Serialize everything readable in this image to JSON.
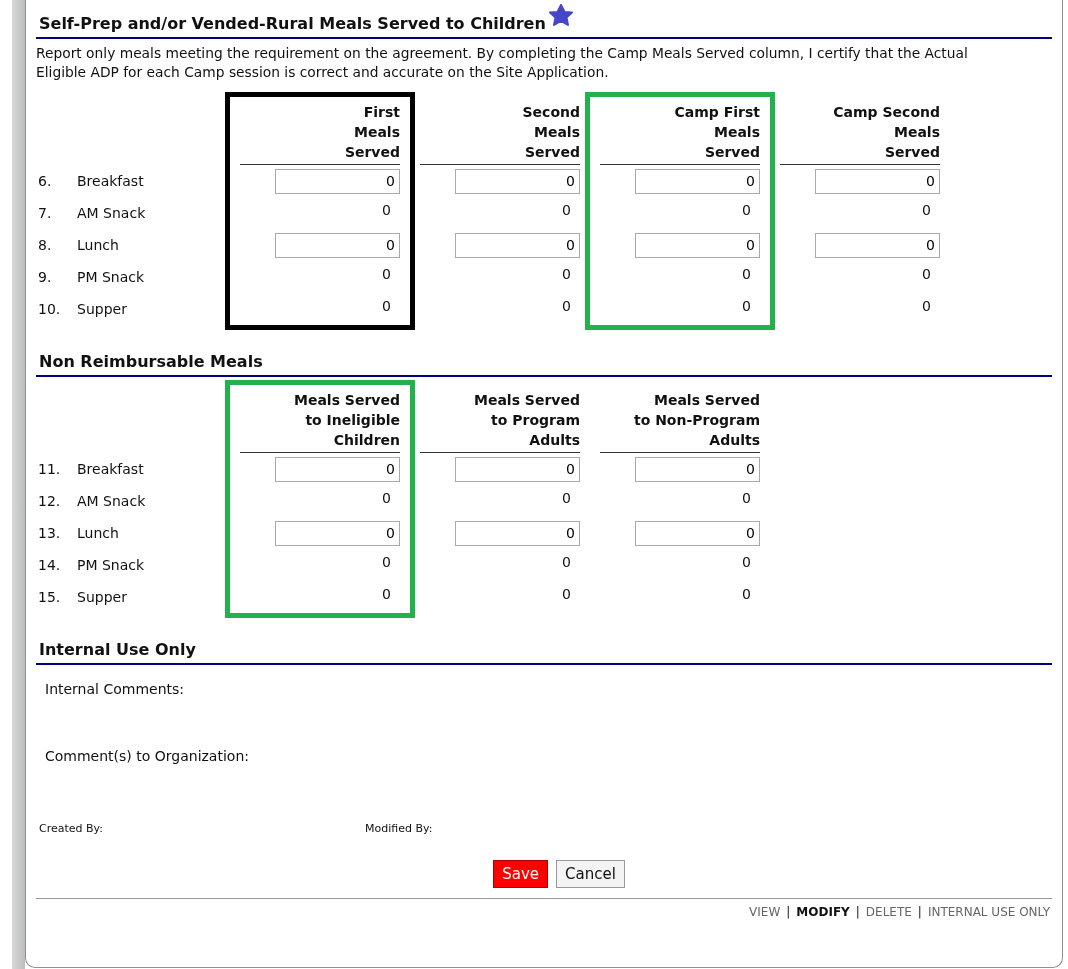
{
  "sections": [
    {
      "title": "Self-Prep and/or Vended-Rural Meals Served to Children",
      "has_star": true,
      "description": "Report only meals meeting the requirement on the agreement. By completing the Camp Meals Served column, I certify that the Actual Eligible ADP for each Camp session is correct and accurate on the Site Application.",
      "columns": [
        {
          "heading": [
            "First",
            "Meals",
            "Served"
          ],
          "color": "#000000"
        },
        {
          "heading": [
            "Second",
            "Meals",
            "Served"
          ]
        },
        {
          "heading": [
            "Camp First",
            "Meals",
            "Served"
          ],
          "color": "#22b14c"
        },
        {
          "heading": [
            "Camp Second",
            "Meals",
            "Served"
          ]
        }
      ],
      "rows": [
        {
          "number": "6.",
          "label": "Breakfast",
          "kind": "input",
          "values": [
            "0",
            "0",
            "0",
            "0"
          ]
        },
        {
          "number": "7.",
          "label": "AM Snack",
          "kind": "text",
          "values": [
            "0",
            "0",
            "0",
            "0"
          ]
        },
        {
          "number": "8.",
          "label": "Lunch",
          "kind": "input",
          "values": [
            "0",
            "0",
            "0",
            "0"
          ]
        },
        {
          "number": "9.",
          "label": "PM Snack",
          "kind": "text",
          "values": [
            "0",
            "0",
            "0",
            "0"
          ]
        },
        {
          "number": "10.",
          "label": "Supper",
          "kind": "text",
          "values": [
            "0",
            "0",
            "0",
            "0"
          ]
        }
      ]
    },
    {
      "title": "Non Reimbursable Meals",
      "columns": [
        {
          "heading": [
            "Meals Served",
            "to Ineligible",
            "Children"
          ],
          "color": "#22b14c"
        },
        {
          "heading": [
            "Meals Served",
            "to Program",
            "Adults"
          ]
        },
        {
          "heading": [
            "Meals Served",
            "to Non-Program",
            "Adults"
          ]
        }
      ],
      "rows": [
        {
          "number": "11.",
          "label": "Breakfast",
          "kind": "input",
          "values": [
            "0",
            "0",
            "0"
          ]
        },
        {
          "number": "12.",
          "label": "AM Snack",
          "kind": "text",
          "values": [
            "0",
            "0",
            "0"
          ]
        },
        {
          "number": "13.",
          "label": "Lunch",
          "kind": "input",
          "values": [
            "0",
            "0",
            "0"
          ]
        },
        {
          "number": "14.",
          "label": "PM Snack",
          "kind": "text",
          "values": [
            "0",
            "0",
            "0"
          ]
        },
        {
          "number": "15.",
          "label": "Supper",
          "kind": "text",
          "values": [
            "0",
            "0",
            "0"
          ]
        }
      ]
    }
  ],
  "internal": {
    "title": "Internal Use Only",
    "fields": [
      "Internal Comments:",
      "Comment(s) to Organization:"
    ]
  },
  "audit": {
    "created_by": "Created By:",
    "modified_by": "Modified By:"
  },
  "buttons": [
    {
      "label": "Save",
      "kind": "primary"
    },
    {
      "label": "Cancel",
      "kind": "secondary"
    }
  ],
  "footer_links": [
    {
      "label": "VIEW",
      "selected": false
    },
    {
      "label": "MODIFY",
      "selected": true
    },
    {
      "label": "DELETE",
      "selected": false
    },
    {
      "label": "INTERNAL USE ONLY",
      "selected": false
    }
  ],
  "footer_separator": [
    "|",
    "|",
    "|"
  ]
}
